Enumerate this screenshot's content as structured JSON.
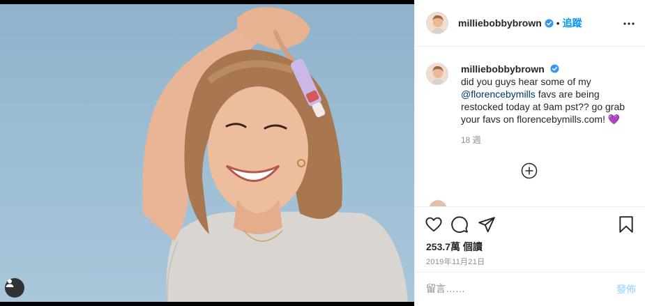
{
  "post": {
    "username": "milliebobbybrown",
    "separator": "•",
    "follow_label": "追蹤",
    "caption": {
      "username": "milliebobbybrown",
      "text_before": "did you guys hear some of my ",
      "mention": "@florencebymills",
      "text_after": " favs are being restocked today at 9am pst?? go grab your favs on florencebymills.com!",
      "emoji": "💜",
      "time_ago": "18 週"
    },
    "stats": {
      "views": "253.7萬 個讀"
    },
    "date": "2019年11月21日",
    "comment": {
      "placeholder": "留言……",
      "post_label": "發佈"
    }
  },
  "colors": {
    "accent": "#0095f6",
    "verified": "#3897f0",
    "mention": "#00376b",
    "muted": "#8e8e8e",
    "post_disabled": "#b2dffc",
    "photo_background": "#9cbdd3"
  },
  "icons": {
    "verified": "verified-badge-icon",
    "more": "more-options-icon",
    "load_more": "load-more-comments-icon",
    "like": "heart-icon",
    "comment": "comment-icon",
    "share": "share-icon",
    "save": "bookmark-icon",
    "tags": "user-tag-icon"
  }
}
